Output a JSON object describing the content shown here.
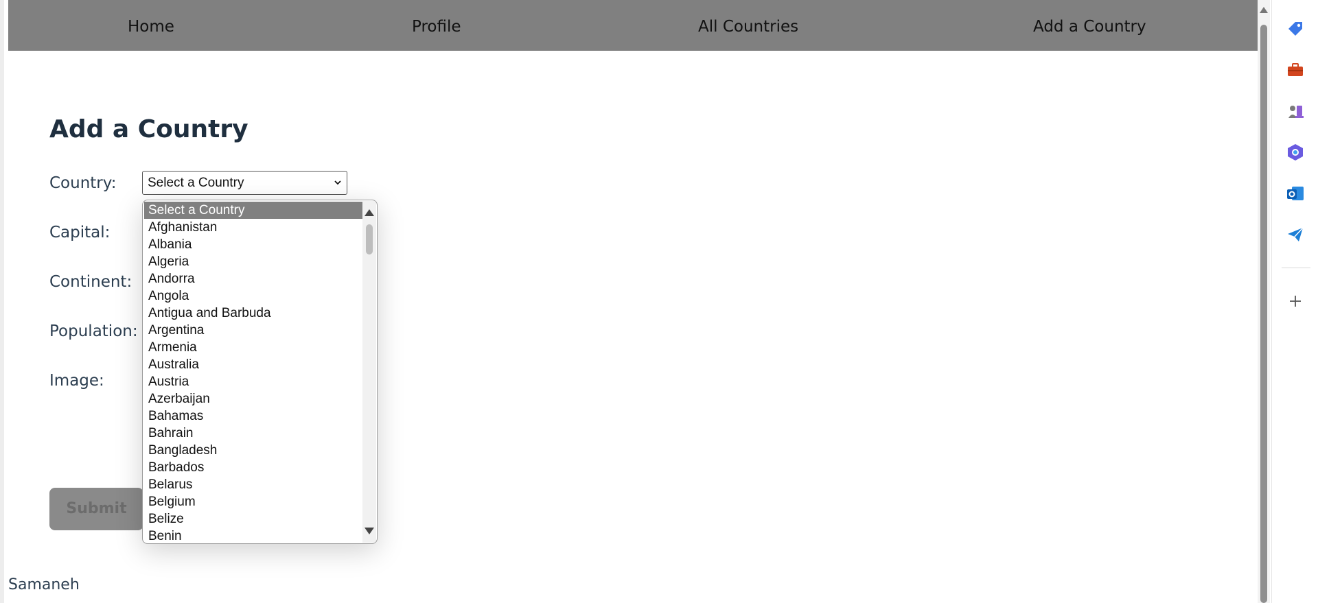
{
  "nav": {
    "home": "Home",
    "profile": "Profile",
    "all_countries": "All Countries",
    "add_country": "Add a Country",
    "bar_color": "#808080"
  },
  "form": {
    "title": "Add a Country",
    "country_label": "Country:",
    "capital_label": "Capital:",
    "continent_label": "Continent:",
    "population_label": "Population:",
    "image_label": "Image:",
    "country_selected": "Select a Country",
    "submit_label": "Submit"
  },
  "dropdown": {
    "options": [
      "Select a Country",
      "Afghanistan",
      "Albania",
      "Algeria",
      "Andorra",
      "Angola",
      "Antigua and Barbuda",
      "Argentina",
      "Armenia",
      "Australia",
      "Austria",
      "Azerbaijan",
      "Bahamas",
      "Bahrain",
      "Bangladesh",
      "Barbados",
      "Belarus",
      "Belgium",
      "Belize",
      "Benin"
    ],
    "highlighted": "Select a Country"
  },
  "footer": {
    "name": "Samaneh"
  },
  "sidebar_icons": [
    "tag-icon",
    "toolbox-icon",
    "chess-icon",
    "copilot-icon",
    "outlook-icon",
    "send-icon",
    "add-icon"
  ]
}
